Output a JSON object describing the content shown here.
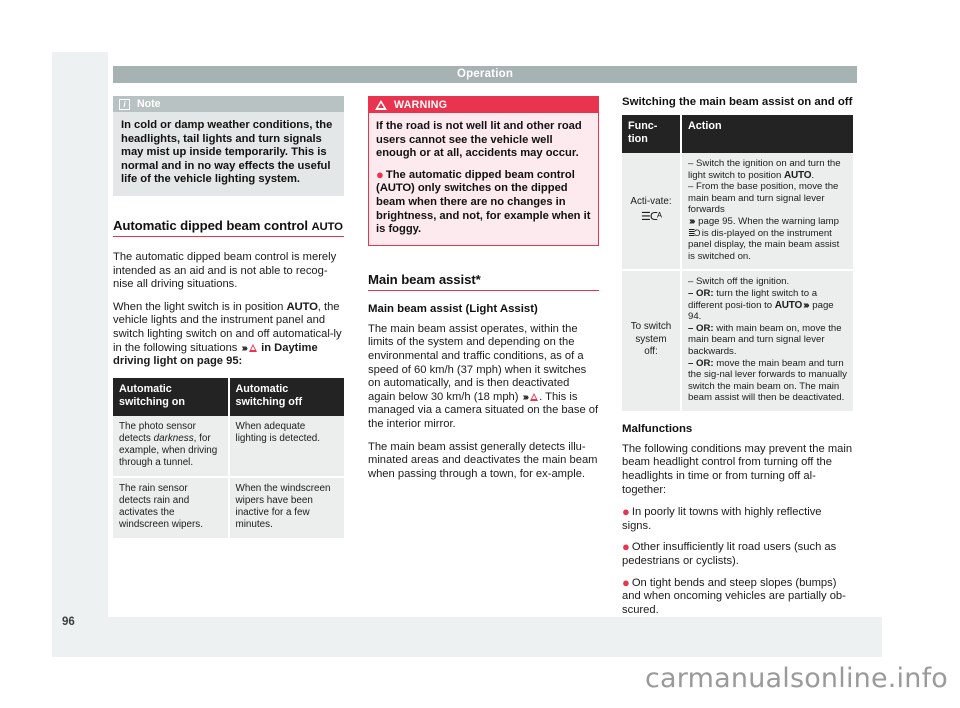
{
  "page": {
    "running_head": "Operation",
    "page_number": "96",
    "watermark": "carmanualsonline.info"
  },
  "note_box": {
    "icon": "info-icon",
    "title": "Note",
    "text": "In cold or damp weather conditions, the headlights, tail lights and turn signals may mist up inside temporarily. This is normal and in no way effects the useful life of the vehicle lighting system."
  },
  "warning_box": {
    "icon": "warning-triangle-icon",
    "title": "WARNING",
    "paragraph_1": "If the road is not well lit and other road users cannot see the vehicle well enough or at all, accidents may occur.",
    "bullet_1_pre": "The automatic dipped beam control (",
    "bullet_1_auto": "AUTO",
    "bullet_1_post": ") only switches on the dipped beam when there are no changes in brightness, and not, for example when it is foggy."
  },
  "section_dipped": {
    "heading_text": "Automatic dipped beam control ",
    "heading_auto": "AUTO",
    "para_1": "The automatic dipped beam control is merely intended as an aid and is not able to recog-nise all driving situations.",
    "para_2_a": "When the light switch is in position ",
    "para_2_auto": "AUTO",
    "para_2_b": ", the vehicle lights and the instrument panel and switch lighting switch on and off automatical-ly in the following situations ",
    "para_2_arrows": "›››",
    "para_2_c": " in Daytime driving light on page 95:",
    "table": {
      "headers": [
        "Automatic switching on",
        "Automatic switching off"
      ],
      "rows": [
        {
          "on_pre": "The photo sensor detects ",
          "on_italic": "darkness",
          "on_post": ", for example, when driving through a tunnel.",
          "off": "When adequate lighting is detected."
        },
        {
          "on_pre": "The rain sensor detects rain and activates the windscreen wipers.",
          "on_italic": "",
          "on_post": "",
          "off": "When the windscreen wipers have been inactive for a few minutes."
        }
      ]
    }
  },
  "section_main_beam": {
    "heading": "Main beam assist*",
    "sub_head": "Main beam assist (Light Assist)",
    "para_1_a": "The main beam assist operates, within the limits of the system and depending on the environmental and traffic conditions, as of a speed of 60 km/h (37 mph) when it switches on automatically, and is then deactivated again below 30 km/h (18 mph) ",
    "para_1_arrows": "›››",
    "para_1_b": ". This is managed via a camera situated on the base of the interior mirror.",
    "para_2": "The main beam assist generally detects illu-minated areas and deactivates the main beam when passing through a town, for ex-ample."
  },
  "section_switching": {
    "heading": "Switching the main beam assist on and off",
    "table": {
      "headers": [
        "Func-tion",
        "Action"
      ],
      "rows": [
        {
          "function_label": "Acti-vate:",
          "function_icon": "light-assist-icon",
          "action_line_1": "– Switch the ignition on and turn the light switch to position ",
          "action_line_1_auto": "AUTO",
          "action_line_1_end": ".",
          "action_line_2": "– From the base position, move the main beam and turn signal lever forwards",
          "action_line_3_arrows": "›››",
          "action_line_3_a": " page 95. When the warning lamp ",
          "action_line_3_lamp": "lamp-icon",
          "action_line_3_b": " is dis-played on the instrument panel display, the main beam assist is switched on."
        },
        {
          "function_label": "To switch system off:",
          "function_icon": "",
          "action_line_1": "– Switch off the ignition.",
          "action_line_2_or": "– OR:",
          "action_line_2_a": " turn the light switch to a different posi-tion to ",
          "action_line_2_auto": "AUTO",
          "action_line_2_arrows": "›››",
          "action_line_2_b": " page 94.",
          "action_line_3_or": "– OR:",
          "action_line_3": " with main beam on, move the main beam and turn signal lever backwards.",
          "action_line_4_or": "– OR:",
          "action_line_4": " move the main beam and turn the sig-nal lever forwards to manually switch the main beam on. The main beam assist will then be deactivated."
        }
      ]
    }
  },
  "section_malfunctions": {
    "heading": "Malfunctions",
    "para_1": "The following conditions may prevent the main beam headlight control from turning off the headlights in time or from turning off al-together:",
    "bullets": [
      "In poorly lit towns with highly reflective signs.",
      "Other insufficiently lit road users (such as pedestrians or cyclists).",
      "On tight bends and steep slopes (bumps) and when oncoming vehicles are partially ob-scured."
    ]
  },
  "colors": {
    "accent_red": "#e8344e",
    "header_gray": "#a7b3b3",
    "table_header": "#232323",
    "table_cell": "#eceeee",
    "page_bg": "#eef1f1"
  }
}
